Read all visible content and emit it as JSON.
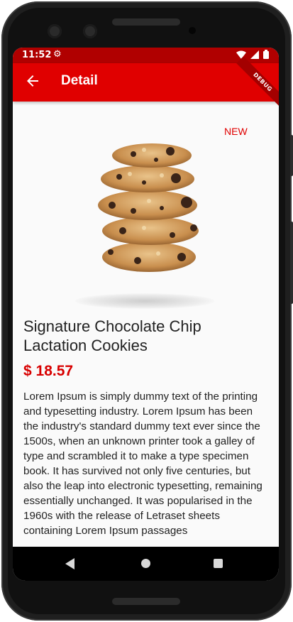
{
  "status_bar": {
    "time": "11:52",
    "settings_icon": "gear-icon",
    "icons": [
      "wifi-icon",
      "signal-icon",
      "battery-icon"
    ]
  },
  "app_bar": {
    "title": "Detail",
    "back_icon": "arrow-back-icon",
    "debug_banner": "DEBUG",
    "color": "#e00000"
  },
  "product": {
    "badge": "NEW",
    "image_icon": "cookie-stack-image",
    "title": "Signature Chocolate Chip Lactation Cookies",
    "price": "$ 18.57",
    "description": "Lorem Ipsum is simply dummy text of the printing and typesetting industry. Lorem Ipsum has been the industry's standard dummy text ever since the 1500s, when an unknown printer took a galley of type and scrambled it to make a type specimen book. It has survived not only five centuries, but also the leap into electronic typesetting, remaining essentially unchanged. It was popularised in the 1960s with the release of Letraset sheets containing Lorem Ipsum passages"
  },
  "nav_bar": {
    "back_icon": "triangle-back-icon",
    "home_icon": "circle-home-icon",
    "recents_icon": "square-recents-icon"
  },
  "colors": {
    "accent": "#e00000",
    "status_bar": "#b00000",
    "price": "#d80000"
  }
}
